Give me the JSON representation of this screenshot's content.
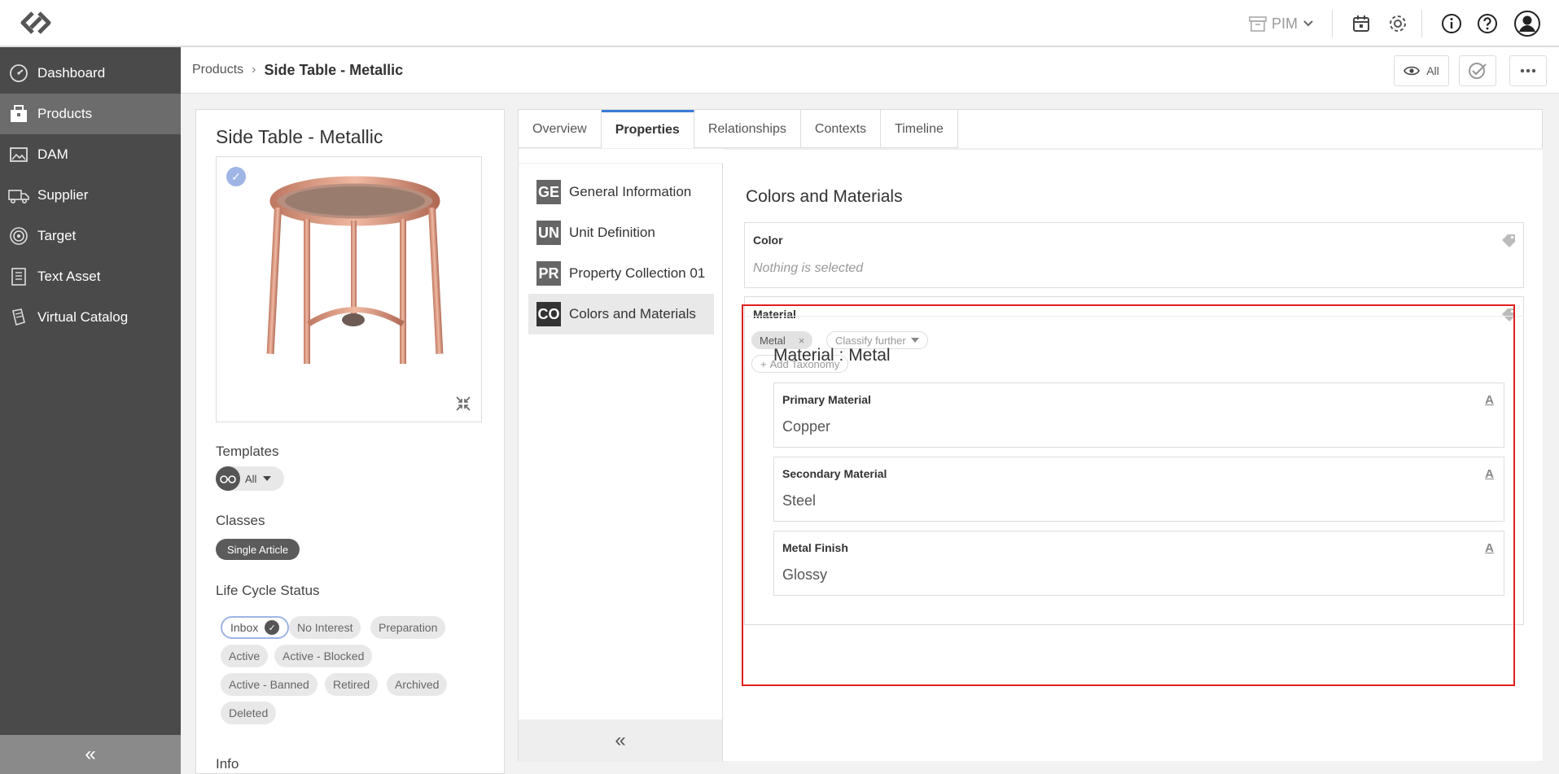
{
  "topbar": {
    "module_switch": "PIM",
    "icons": [
      "logo-icon",
      "archive-icon",
      "chevron-down-icon",
      "calendar-icon",
      "gear-icon",
      "info-icon",
      "help-icon",
      "user-icon"
    ]
  },
  "sidebar": {
    "items": [
      {
        "label": "Dashboard",
        "icon": "dashboard-icon"
      },
      {
        "label": "Products",
        "icon": "products-icon",
        "active": true
      },
      {
        "label": "DAM",
        "icon": "image-icon"
      },
      {
        "label": "Supplier",
        "icon": "truck-icon"
      },
      {
        "label": "Target",
        "icon": "target-icon"
      },
      {
        "label": "Text Asset",
        "icon": "document-icon"
      },
      {
        "label": "Virtual Catalog",
        "icon": "catalog-icon"
      }
    ],
    "collapse": "«"
  },
  "breadcrumb": {
    "root": "Products",
    "separator": "›",
    "current": "Side Table - Metallic",
    "view_filter": "All"
  },
  "product": {
    "title": "Side Table - Metallic",
    "templates_label": "Templates",
    "template_value": "All",
    "classes_label": "Classes",
    "class_value": "Single Article",
    "lifecycle_label": "Life Cycle Status",
    "statuses": [
      "Inbox",
      "No Interest",
      "Preparation",
      "Active",
      "Active - Blocked",
      "Active - Banned",
      "Retired",
      "Archived",
      "Deleted"
    ],
    "selected_status": "Inbox",
    "info_label": "Info"
  },
  "tabs": [
    "Overview",
    "Properties",
    "Relationships",
    "Contexts",
    "Timeline"
  ],
  "active_tab": "Properties",
  "groups": [
    {
      "code": "GE",
      "label": "General Information"
    },
    {
      "code": "UN",
      "label": "Unit Definition"
    },
    {
      "code": "PR",
      "label": "Property Collection 01"
    },
    {
      "code": "CO",
      "label": "Colors and Materials",
      "active": true
    }
  ],
  "groups_collapse": "«",
  "content": {
    "section_title": "Colors and Materials",
    "color": {
      "label": "Color",
      "placeholder": "Nothing is selected"
    },
    "material": {
      "label": "Material",
      "selected_taxonomy": "Metal",
      "remove": "×",
      "classify_further": "Classify further",
      "add_taxonomy": "Add Taxonomy",
      "add_prefix": "+"
    },
    "material_detail": {
      "title": "Material : Metal",
      "fields": [
        {
          "label": "Primary Material",
          "value": "Copper"
        },
        {
          "label": "Secondary Material",
          "value": "Steel"
        },
        {
          "label": "Metal Finish",
          "value": "Glossy"
        }
      ],
      "text_icon": "A"
    }
  },
  "colors": {
    "accent": "#3a7bd5",
    "sidebar_bg": "#4a4a4a",
    "highlight": "#e02020"
  }
}
